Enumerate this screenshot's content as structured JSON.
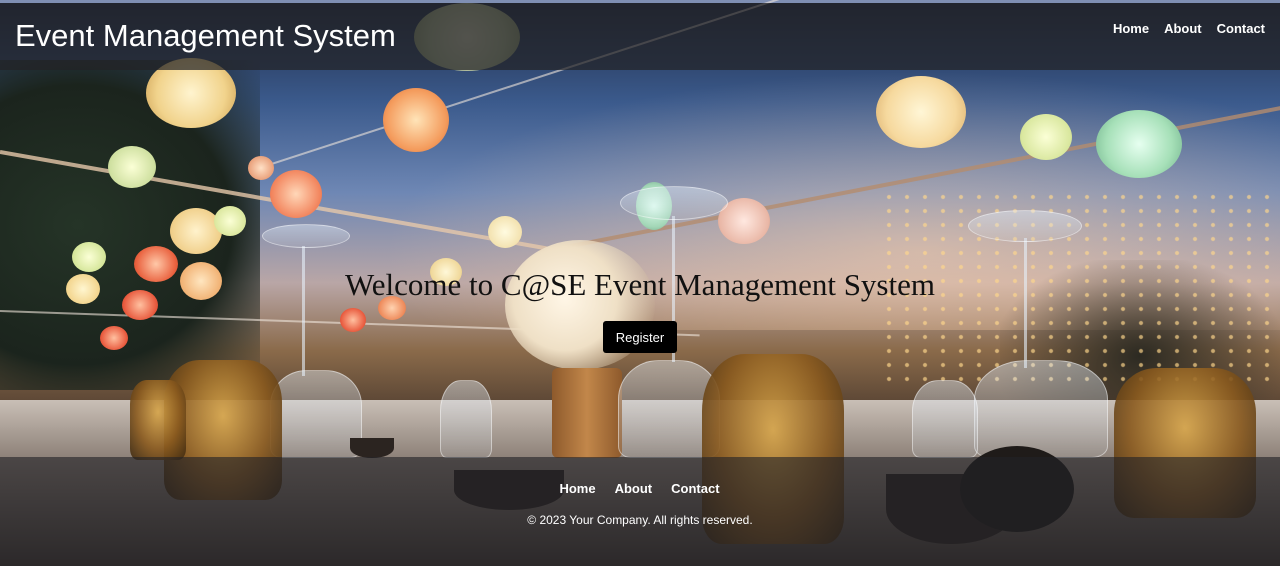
{
  "header": {
    "title": "Event Management System",
    "nav": [
      "Home",
      "About",
      "Contact"
    ]
  },
  "hero": {
    "heading": "Welcome to C@SE Event Management System",
    "register_label": "Register"
  },
  "footer": {
    "nav": [
      "Home",
      "About",
      "Contact"
    ],
    "copyright": "© 2023 Your Company. All rights reserved."
  },
  "colors": {
    "header_bg": "#222226",
    "footer_bg": "#222226",
    "button_bg": "#000000",
    "nav_text": "#ffffff",
    "heading_text": "#111111"
  }
}
